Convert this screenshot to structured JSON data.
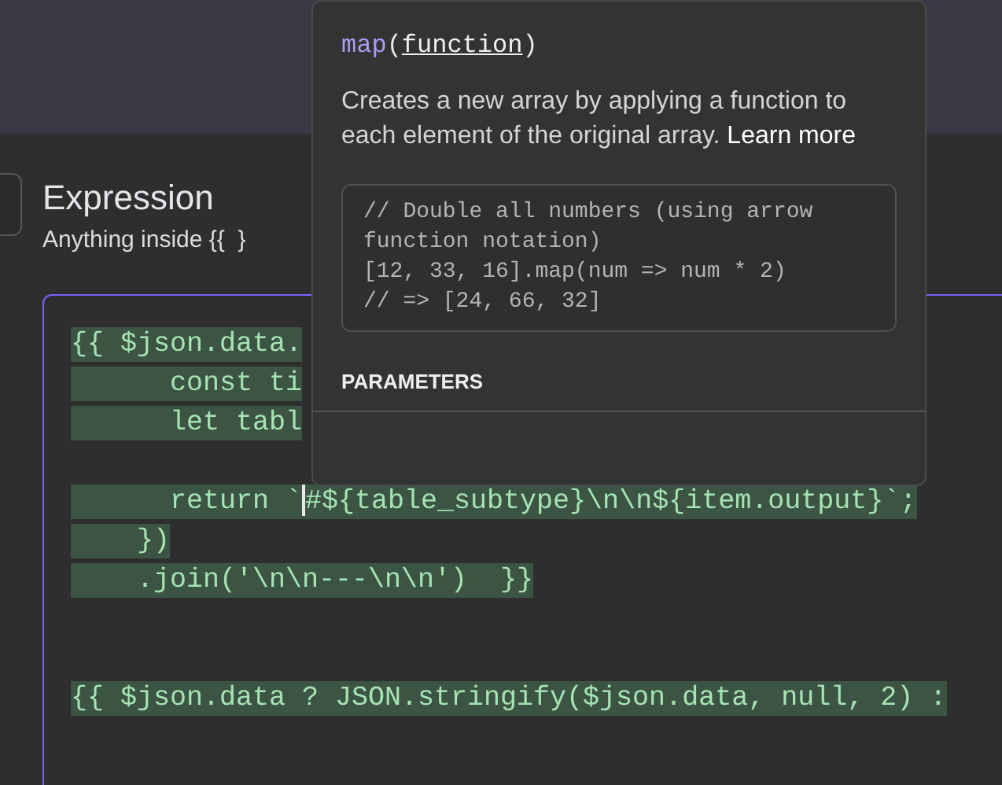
{
  "section": {
    "title": "Expression",
    "hint": "Anything inside {{  }"
  },
  "editor": {
    "focused": true,
    "lines": [
      {
        "kind": "code",
        "text": "{{ $json.data.",
        "selected": true
      },
      {
        "kind": "code",
        "text": "      const ti",
        "selected": true
      },
      {
        "kind": "code",
        "text": "      let tabl",
        "selected": true
      },
      {
        "kind": "blank"
      },
      {
        "kind": "code",
        "text": "      return `",
        "text_after_cursor": "#${table_subtype}\\n\\n${item.output}`;",
        "selected": true
      },
      {
        "kind": "code",
        "text": "    })",
        "selected": true
      },
      {
        "kind": "code",
        "text": "    .join('\\n\\n---\\n\\n')  }}",
        "selected": true
      },
      {
        "kind": "blank"
      },
      {
        "kind": "blank"
      },
      {
        "kind": "code",
        "text": "{{ $json.data ? JSON.stringify($json.data, null, 2) :",
        "selected": true
      }
    ]
  },
  "tooltip": {
    "signature": [
      {
        "kind": "name",
        "text": "map"
      },
      {
        "kind": "punct",
        "text": "("
      },
      {
        "kind": "param",
        "text": "function"
      },
      {
        "kind": "punct",
        "text": ")"
      }
    ],
    "description": "Creates a new array by applying a function to each element of the original array.",
    "link": "Learn more",
    "example": [
      "// Double all numbers (using arrow function notation)",
      "[12, 33, 16].map(num => num * 2)",
      "// => [24, 66, 32]"
    ],
    "parameters_heading": "PARAMETERS"
  }
}
